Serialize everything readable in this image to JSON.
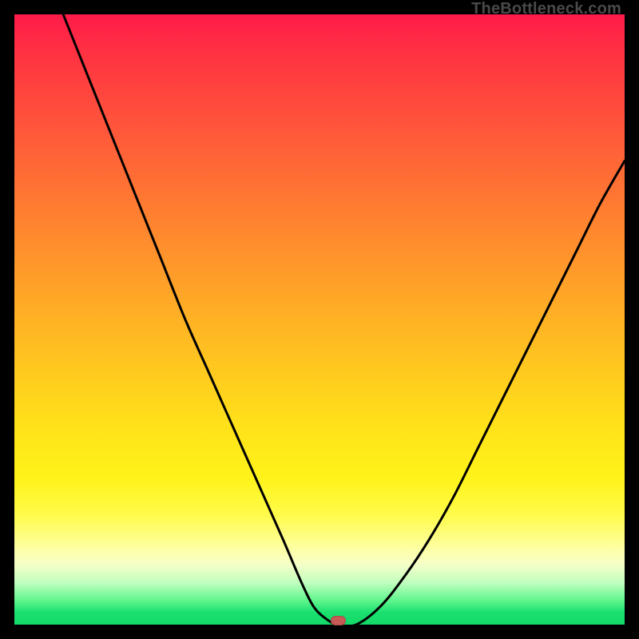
{
  "credit": "TheBottleneck.com",
  "colors": {
    "curve_stroke": "#000000",
    "background_black": "#000000",
    "marker_fill": "#c65a55"
  },
  "chart_data": {
    "type": "line",
    "title": "",
    "xlabel": "",
    "ylabel": "",
    "xlim": [
      0,
      100
    ],
    "ylim": [
      0,
      100
    ],
    "grid": false,
    "legend": false,
    "series": [
      {
        "name": "bottleneck-curve",
        "x": [
          8,
          12,
          16,
          20,
          24,
          28,
          32,
          36,
          40,
          44,
          47,
          49,
          51,
          53,
          56,
          60,
          64,
          68,
          72,
          76,
          80,
          84,
          88,
          92,
          96,
          100
        ],
        "y": [
          100,
          90,
          80,
          70,
          60,
          50,
          41,
          32,
          23,
          14,
          7,
          3,
          1,
          0,
          0,
          3,
          8,
          14,
          21,
          29,
          37,
          45,
          53,
          61,
          69,
          76
        ]
      }
    ],
    "annotations": [
      {
        "name": "bottleneck-marker",
        "x": 53,
        "y": 0.6
      }
    ],
    "gradient_stops": [
      {
        "pos": 0.0,
        "color": "#ff1b4a"
      },
      {
        "pos": 0.5,
        "color": "#ffb223"
      },
      {
        "pos": 0.8,
        "color": "#fff31a"
      },
      {
        "pos": 0.92,
        "color": "#e8ffc4"
      },
      {
        "pos": 1.0,
        "color": "#14d968"
      }
    ]
  }
}
